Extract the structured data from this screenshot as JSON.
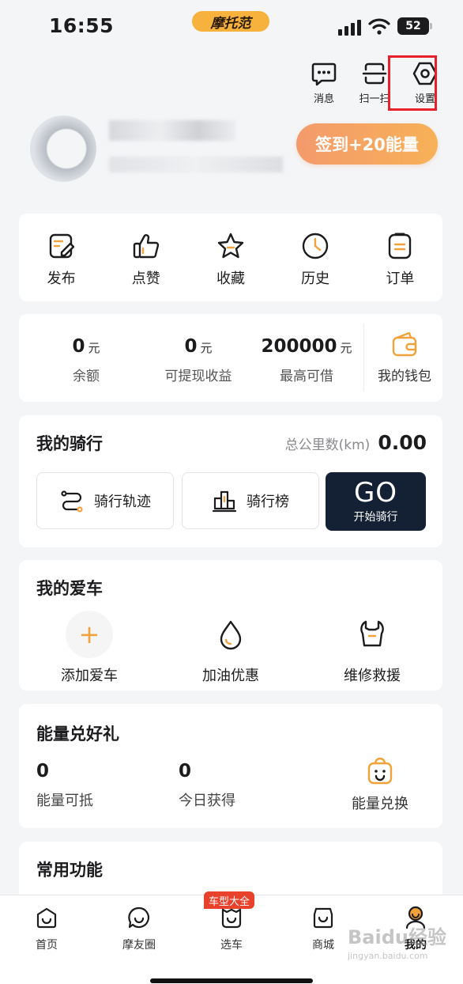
{
  "status_bar": {
    "time": "16:55",
    "app_name": "摩托范",
    "battery": "52"
  },
  "top_actions": [
    {
      "label": "消息",
      "icon": "message-icon"
    },
    {
      "label": "扫一扫",
      "icon": "scan-icon"
    },
    {
      "label": "设置",
      "icon": "settings-icon"
    }
  ],
  "profile": {
    "checkin_label": "签到+20能量"
  },
  "quick_menu": [
    {
      "label": "发布",
      "icon": "edit-icon"
    },
    {
      "label": "点赞",
      "icon": "thumbs-up-icon"
    },
    {
      "label": "收藏",
      "icon": "star-icon"
    },
    {
      "label": "历史",
      "icon": "clock-icon"
    },
    {
      "label": "订单",
      "icon": "order-icon"
    }
  ],
  "wallet": {
    "balance": {
      "value": "0",
      "unit": "元",
      "label": "余额"
    },
    "withdrawable": {
      "value": "0",
      "unit": "元",
      "label": "可提现收益"
    },
    "credit": {
      "value": "200000",
      "unit": "元",
      "label": "最高可借"
    },
    "wallet_label": "我的钱包"
  },
  "riding": {
    "title": "我的骑行",
    "total_label": "总公里数(km)",
    "total_value": "0.00",
    "track_label": "骑行轨迹",
    "rank_label": "骑行榜",
    "go_label": "GO",
    "go_sub": "开始骑行"
  },
  "my_car": {
    "title": "我的爱车",
    "items": [
      {
        "label": "添加爱车",
        "icon": "plus-icon"
      },
      {
        "label": "加油优惠",
        "icon": "fuel-drop-icon"
      },
      {
        "label": "维修救援",
        "icon": "repair-icon"
      }
    ]
  },
  "energy": {
    "title": "能量兑好礼",
    "deductible": {
      "value": "0",
      "label": "能量可抵"
    },
    "today": {
      "value": "0",
      "label": "今日获得"
    },
    "exchange_label": "能量兑换"
  },
  "common": {
    "title": "常用功能"
  },
  "tab_bar": {
    "badge": "车型大全",
    "tabs": [
      {
        "label": "首页",
        "icon": "home-icon"
      },
      {
        "label": "摩友圈",
        "icon": "chat-icon"
      },
      {
        "label": "选车",
        "icon": "select-car-icon"
      },
      {
        "label": "商城",
        "icon": "shop-icon"
      },
      {
        "label": "我的",
        "icon": "profile-icon"
      }
    ]
  },
  "watermark": {
    "text": "Baidu经验",
    "sub": "jingyan.baidu.com"
  },
  "colors": {
    "accent": "#f2a23a",
    "go_button": "#142135",
    "highlight": "#e8202a"
  }
}
